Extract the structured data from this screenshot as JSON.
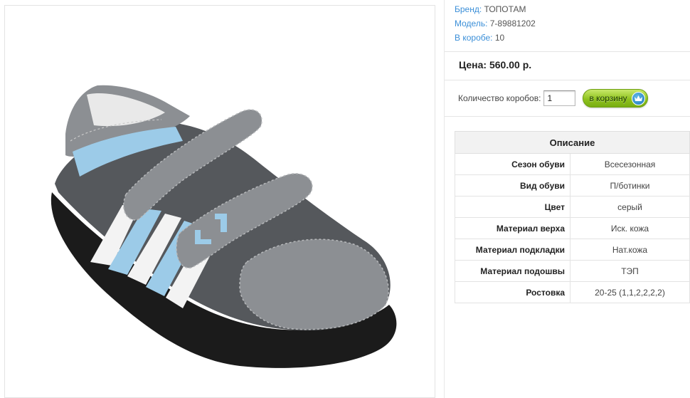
{
  "product_image": {
    "alt": "",
    "colors": {
      "leather": "#8c8f93",
      "mesh": "#55585c",
      "accent": "#9ccbe8",
      "stripe_white": "#f3f3f3",
      "sole": "#1b1b1b"
    }
  },
  "meta": {
    "brand_label": "Бренд:",
    "brand_value": "ТОПОТАМ",
    "model_label": "Модель:",
    "model_value": "7-89881202",
    "box_label": "В коробе:",
    "box_value": "10"
  },
  "price": "Цена: 560.00 р.",
  "order": {
    "qty_label": "Количество коробов:",
    "qty_value": "1",
    "add_to_cart_label": "в корзину",
    "cart_icon": "crown-cart-icon"
  },
  "specs": {
    "title": "Описание",
    "rows": [
      {
        "key": "Сезон обуви",
        "value": "Всесезонная"
      },
      {
        "key": "Вид обуви",
        "value": "П/ботинки"
      },
      {
        "key": "Цвет",
        "value": "серый"
      },
      {
        "key": "Материал верха",
        "value": "Иск. кожа"
      },
      {
        "key": "Материал подкладки",
        "value": "Нат.кожа"
      },
      {
        "key": "Материал подошвы",
        "value": "ТЭП"
      },
      {
        "key": "Ростовка",
        "value": "20-25 (1,1,2,2,2,2)"
      }
    ]
  },
  "colors": {
    "link_blue": "#3b8fd8",
    "button_green": "#8fc31f"
  }
}
